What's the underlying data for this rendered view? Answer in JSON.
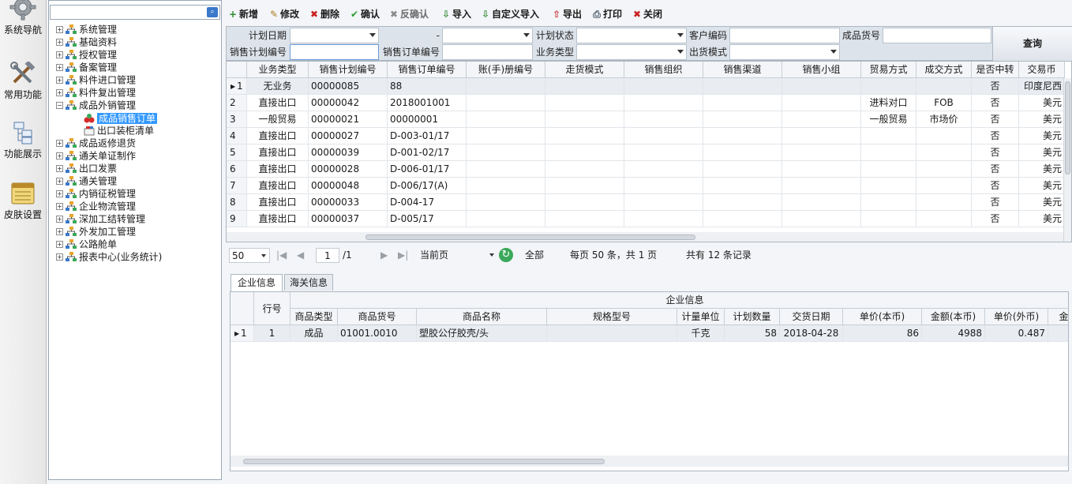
{
  "leftnav": [
    {
      "label": "系统导航",
      "icon": "gear-icon"
    },
    {
      "label": "常用功能",
      "icon": "tools-icon"
    },
    {
      "label": "功能展示",
      "icon": "hierarchy-icon"
    },
    {
      "label": "皮肤设置",
      "icon": "notepad-icon"
    }
  ],
  "tree": [
    {
      "label": "系统管理",
      "level": 0,
      "expanded": false
    },
    {
      "label": "基础资料",
      "level": 0,
      "expanded": false
    },
    {
      "label": "授权管理",
      "level": 0,
      "expanded": false
    },
    {
      "label": "备案管理",
      "level": 0,
      "expanded": false
    },
    {
      "label": "料件进口管理",
      "level": 0,
      "expanded": false
    },
    {
      "label": "料件复出管理",
      "level": 0,
      "expanded": false
    },
    {
      "label": "成品外销管理",
      "level": 0,
      "expanded": true
    },
    {
      "label": "成品销售订单",
      "level": 1,
      "selected": true
    },
    {
      "label": "出口装柜清单",
      "level": 1
    },
    {
      "label": "成品返修退货",
      "level": 0,
      "expanded": false
    },
    {
      "label": "通关单证制作",
      "level": 0,
      "expanded": false
    },
    {
      "label": "出口发票",
      "level": 0,
      "expanded": false
    },
    {
      "label": "通关管理",
      "level": 0,
      "expanded": false
    },
    {
      "label": "内销征税管理",
      "level": 0,
      "expanded": false
    },
    {
      "label": "企业物流管理",
      "level": 0,
      "expanded": false
    },
    {
      "label": "深加工结转管理",
      "level": 0,
      "expanded": false
    },
    {
      "label": "外发加工管理",
      "level": 0,
      "expanded": false
    },
    {
      "label": "公路舱单",
      "level": 0,
      "expanded": false
    },
    {
      "label": "报表中心(业务统计)",
      "level": 0,
      "expanded": false
    }
  ],
  "toolbar": [
    {
      "label": "新增",
      "icon": "plus-icon",
      "color": "#2e8b2e",
      "glyph": "+"
    },
    {
      "label": "修改",
      "icon": "pencil-icon",
      "color": "#b07a20",
      "glyph": "✎"
    },
    {
      "label": "删除",
      "icon": "delete-icon",
      "color": "#cc1f1f",
      "glyph": "✖"
    },
    {
      "label": "确认",
      "icon": "check-icon",
      "color": "#2e9b2e",
      "glyph": "✔"
    },
    {
      "label": "反确认",
      "icon": "uncheck-icon",
      "color": "#8a8a8a",
      "glyph": "✖",
      "disabled": true
    },
    {
      "label": "导入",
      "icon": "import-icon",
      "color": "#2e8b2e",
      "glyph": "⇩"
    },
    {
      "label": "自定义导入",
      "icon": "custom-import-icon",
      "color": "#2e8b2e",
      "glyph": "⇩"
    },
    {
      "label": "导出",
      "icon": "export-icon",
      "color": "#cc3333",
      "glyph": "⇧"
    },
    {
      "label": "打印",
      "icon": "printer-icon",
      "color": "#4a5a6a",
      "glyph": "⎙"
    },
    {
      "label": "关闭",
      "icon": "close-icon",
      "color": "#cc1f1f",
      "glyph": "✖"
    }
  ],
  "filter": {
    "plan_date": "计划日期",
    "range_sep": "-",
    "plan_status": "计划状态",
    "customer_code": "客户编码",
    "product_no": "成品货号",
    "sales_plan_no": "销售计划编号",
    "sales_order_no": "销售订单编号",
    "business_type": "业务类型",
    "ship_mode": "出货模式",
    "query": "查询"
  },
  "maingrid": {
    "columns": [
      "业务类型",
      "销售计划编号",
      "销售订单编号",
      "账(手)册编号",
      "走货模式",
      "销售组织",
      "销售渠道",
      "销售小组",
      "贸易方式",
      "成交方式",
      "是否中转",
      "交易币"
    ],
    "rows": [
      [
        "1",
        "无业务",
        "00000085",
        "88",
        "",
        "",
        "",
        "",
        "",
        "",
        "",
        "否",
        "印度尼西"
      ],
      [
        "2",
        "直接出口",
        "00000042",
        "2018001001",
        "",
        "",
        "",
        "",
        "",
        "进料对口",
        "FOB",
        "否",
        "美元"
      ],
      [
        "3",
        "一般贸易",
        "00000021",
        "00000001",
        "",
        "",
        "",
        "",
        "",
        "一般贸易",
        "市场价",
        "否",
        "美元"
      ],
      [
        "4",
        "直接出口",
        "00000027",
        "D-003-01/17",
        "",
        "",
        "",
        "",
        "",
        "",
        "",
        "否",
        "美元"
      ],
      [
        "5",
        "直接出口",
        "00000039",
        "D-001-02/17",
        "",
        "",
        "",
        "",
        "",
        "",
        "",
        "否",
        "美元"
      ],
      [
        "6",
        "直接出口",
        "00000028",
        "D-006-01/17",
        "",
        "",
        "",
        "",
        "",
        "",
        "",
        "否",
        "美元"
      ],
      [
        "7",
        "直接出口",
        "00000048",
        "D-006/17(A)",
        "",
        "",
        "",
        "",
        "",
        "",
        "",
        "否",
        "美元"
      ],
      [
        "8",
        "直接出口",
        "00000033",
        "D-004-17",
        "",
        "",
        "",
        "",
        "",
        "",
        "",
        "否",
        "美元"
      ],
      [
        "9",
        "直接出口",
        "00000037",
        "D-005/17",
        "",
        "",
        "",
        "",
        "",
        "",
        "",
        "否",
        "美元"
      ]
    ]
  },
  "pager": {
    "page_size": "50",
    "current_page": "1",
    "total_pages": "/1",
    "scope": "当前页",
    "all": "全部",
    "per_page_info": "每页 50 条，共 1 页",
    "total_info": "共有 12 条记录"
  },
  "tabs": [
    "企业信息",
    "海关信息"
  ],
  "detail": {
    "row_no_header": "行号",
    "group_header": "企业信息",
    "columns": [
      "商品类型",
      "商品货号",
      "商品名称",
      "规格型号",
      "计量单位",
      "计划数量",
      "交货日期",
      "单价(本币)",
      "金额(本币)",
      "单价(外币)",
      "金"
    ],
    "rows": [
      [
        "1",
        "1",
        "成品",
        "01001.0010",
        "塑胶公仔胶壳/头",
        "",
        "千克",
        "58",
        "2018-04-28",
        "86",
        "4988",
        "0.487",
        ""
      ]
    ]
  }
}
